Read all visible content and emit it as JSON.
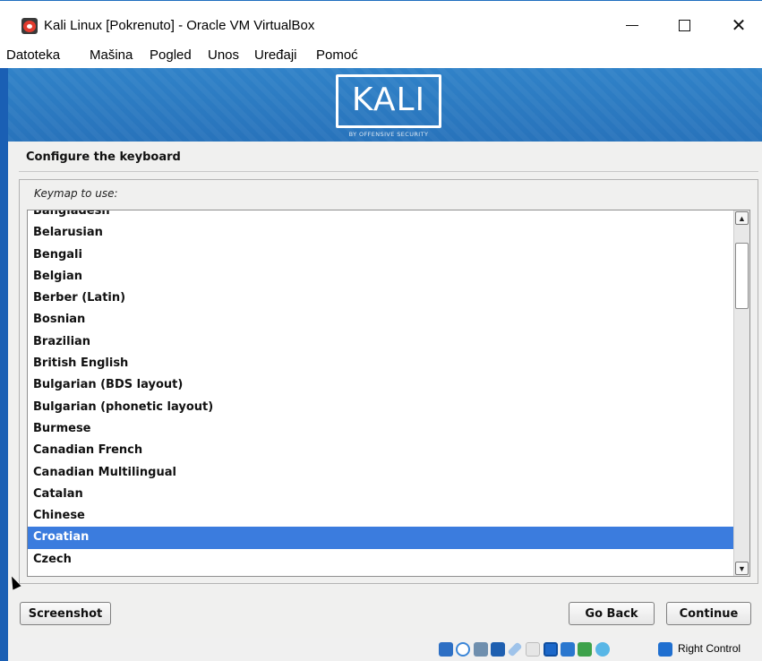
{
  "window": {
    "title": "Kali Linux [Pokrenuto] - Oracle VM VirtualBox",
    "minimize_glyph": "",
    "maximize_glyph": "",
    "close_glyph": "✕"
  },
  "menubar": {
    "items": [
      "Datoteka",
      "Mašina",
      "Pogled",
      "Unos",
      "Uređaji",
      "Pomoć"
    ]
  },
  "banner": {
    "logo_text": "KALI",
    "logo_subtitle": "BY OFFENSIVE SECURITY"
  },
  "installer": {
    "page_title": "Configure the keyboard",
    "frame_label": "Keymap to use:",
    "keymaps": [
      "Bangladesh",
      "Belarusian",
      "Bengali",
      "Belgian",
      "Berber (Latin)",
      "Bosnian",
      "Brazilian",
      "British English",
      "Bulgarian (BDS layout)",
      "Bulgarian (phonetic layout)",
      "Burmese",
      "Canadian French",
      "Canadian Multilingual",
      "Catalan",
      "Chinese",
      "Croatian",
      "Czech"
    ],
    "selected_keymap": "Croatian",
    "scroll_up_glyph": "▲",
    "scroll_down_glyph": "▼",
    "screenshot_label": "Screenshot",
    "go_back_label": "Go Back",
    "continue_label": "Continue"
  },
  "statusbar": {
    "host_key_label": "Right Control",
    "icons": [
      "hard-disk-icon",
      "optical-drive-icon",
      "audio-icon",
      "network-icon",
      "usb-icon",
      "shared-folders-icon",
      "display-icon",
      "video-capture-icon",
      "cpu-icon",
      "mouse-integration-icon",
      "host-key-arrow-icon"
    ]
  },
  "colors": {
    "selection": "#3b7cde",
    "banner": "#2a78c0",
    "accent": "#1a5fb4"
  }
}
